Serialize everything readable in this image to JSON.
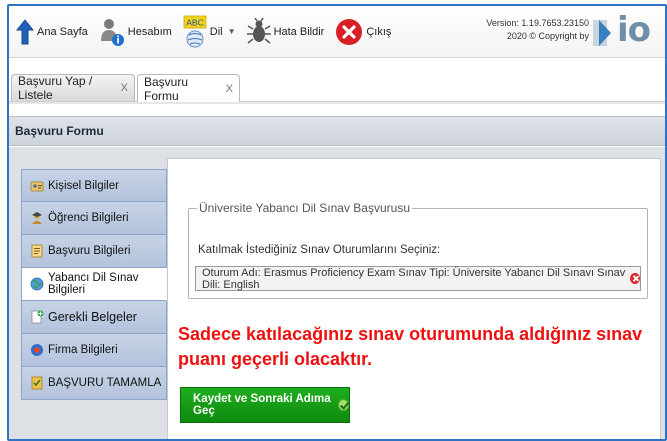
{
  "toolbar": {
    "home_label": "Ana Sayfa",
    "account_label": "Hesabım",
    "language_icon_text": "ABC",
    "language_label": "Dil",
    "report_bug_label": "Hata Bildir",
    "exit_label": "Çıkış",
    "version_line": "Version: 1.19.7653.23150",
    "copyright_line": "2020 © Copyright by",
    "logo_text": "io"
  },
  "tabs": [
    {
      "label": "Başvuru Yap / Listele",
      "close": "X"
    },
    {
      "label": "Başvuru Formu",
      "close": "X"
    }
  ],
  "panel": {
    "title": "Başvuru Formu"
  },
  "menu": [
    {
      "label": "Kişisel Bilgiler",
      "icon": "person-card-icon"
    },
    {
      "label": "Öğrenci Bilgileri",
      "icon": "student-icon"
    },
    {
      "label": "Başvuru Bilgileri",
      "icon": "document-icon"
    },
    {
      "label": "Yabancı Dil Sınav Bilgileri",
      "icon": "globe-icon"
    },
    {
      "label": "Gerekli Belgeler",
      "icon": "add-document-icon"
    },
    {
      "label": "Firma Bilgileri",
      "icon": "company-icon"
    },
    {
      "label": "BAŞVURU TAMAMLA",
      "icon": "checklist-icon"
    }
  ],
  "form": {
    "legend": "Üniversite Yabancı Dil Sınav Başvurusu",
    "prompt": "Katılmak İstediğiniz Sınav Oturumlarını Seçiniz:",
    "selected_session": "Oturum Adı: Erasmus Proficiency Exam Sınav Tipi: Üniversite Yabancı Dil Sınavı Sınav Dili: English",
    "warning": "Sadece katılacağınız sınav oturumunda aldığınız sınav puanı geçerli olacaktır.",
    "save_button": "Kaydet ve Sonraki Adıma Geç"
  },
  "colors": {
    "accent_blue": "#2f73c4",
    "warning_red": "#ee1111",
    "button_green": "#149a14",
    "menu_blue": "#b3c3dc"
  }
}
